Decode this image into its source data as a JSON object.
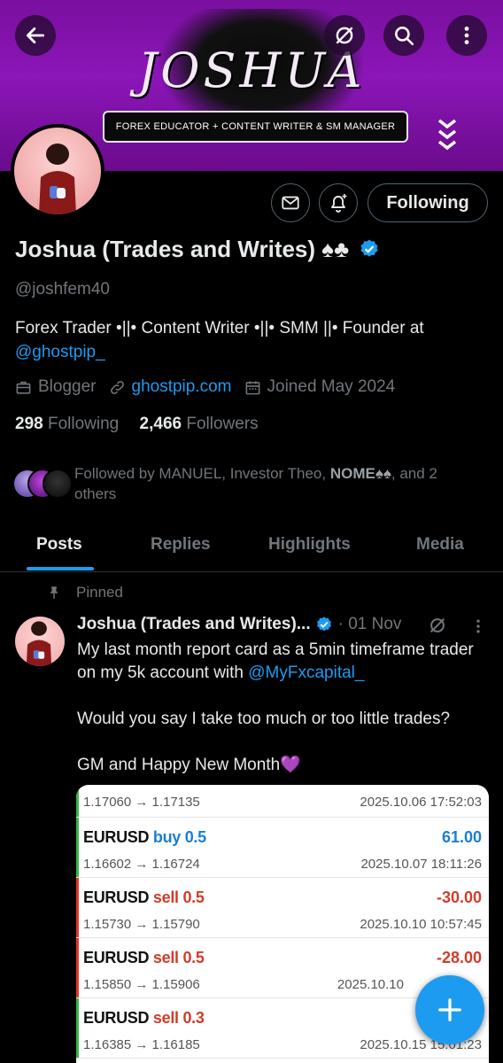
{
  "banner": {
    "logo_text": "JOSHUA",
    "tagline": "FOREX EDUCATOR + CONTENT WRITER & SM MANAGER"
  },
  "profile": {
    "display_name": "Joshua (Trades and Writes) ♠♣",
    "handle": "@joshfem40",
    "bio_text": "Forex Trader •||• Content Writer •||• SMM ||• Founder at ",
    "bio_link": "@ghostpip_",
    "category": "Blogger",
    "website": "ghostpip.com",
    "joined": "Joined May 2024",
    "following_count": "298",
    "following_label": "Following",
    "followers_count": "2,466",
    "followers_label": "Followers",
    "follow_button": "Following",
    "followed_by_prefix": "Followed by MANUEL, Investor Theo, ",
    "followed_by_bold": "NOME♠♠",
    "followed_by_suffix": ", and 2 others"
  },
  "tabs": [
    {
      "label": "Posts",
      "active": true
    },
    {
      "label": "Replies",
      "active": false
    },
    {
      "label": "Highlights",
      "active": false
    },
    {
      "label": "Media",
      "active": false
    }
  ],
  "post": {
    "pinned_label": "Pinned",
    "author": "Joshua (Trades and Writes)...",
    "date": "· 01 Nov",
    "line1_prefix": "My last month report card as a 5min timeframe trader on my 5k account with ",
    "line1_link": "@MyFxcapital_",
    "line2": "Would you say I take too much or too little trades?",
    "line3": "GM and Happy New Month💜"
  },
  "trades": [
    {
      "symbol": "",
      "side": "",
      "pl": "",
      "prices": "1.17060 → 1.17135",
      "time": "2025.10.06 17:52:03",
      "bar": "#3ab54a",
      "pl_color": "#1a7fd0",
      "side_color": "#d23c2a"
    },
    {
      "symbol": "EURUSD",
      "side": "buy 0.5",
      "pl": "61.00",
      "prices": "1.16602 → 1.16724",
      "time": "2025.10.07 18:11:26",
      "bar": "#3ab54a",
      "pl_color": "#1a7fd0",
      "side_color": "#1a7fd0"
    },
    {
      "symbol": "EURUSD",
      "side": "sell 0.5",
      "pl": "-30.00",
      "prices": "1.15730 → 1.15790",
      "time": "2025.10.10 10:57:45",
      "bar": "#e0392b",
      "pl_color": "#d23c2a",
      "side_color": "#d23c2a"
    },
    {
      "symbol": "EURUSD",
      "side": "sell 0.5",
      "pl": "-28.00",
      "prices": "1.15850 → 1.15906",
      "time": "2025.10.10",
      "bar": "#e0392b",
      "pl_color": "#d23c2a",
      "side_color": "#d23c2a"
    },
    {
      "symbol": "EURUSD",
      "side": "sell 0.3",
      "pl": "",
      "prices": "1.16385 → 1.16185",
      "time": "2025.10.15 15:01:23",
      "bar": "#3ab54a",
      "pl_color": "#1a7fd0",
      "side_color": "#d23c2a"
    }
  ],
  "colors": {
    "accent": "#1d9bf0",
    "banner_purple": "#8c16b8",
    "muted": "#71767b"
  }
}
